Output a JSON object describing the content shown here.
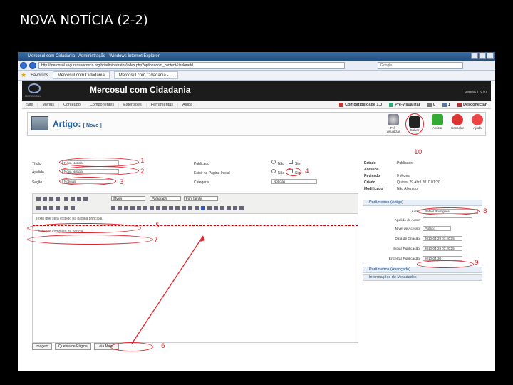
{
  "slide": {
    "title": "NOVA NOTÍCIA (2-2)"
  },
  "browser": {
    "window_title": "Mercosul com Cidadania - Administração - Windows Internet Explorer",
    "address": "http://mercosul.seguranseocosco.org.br/administrator/index.php?option=com_content&task=add",
    "search_placeholder": "Google",
    "favorites_label": "Favoritos",
    "tab_label": "Mercosul com Cidadania",
    "tab2_label": "Mercosul com Cidadania - ..."
  },
  "cms": {
    "site_name": "Mercosul com Cidadania",
    "logo_text": "MERCOSUL",
    "version": "Versão 1.5.10",
    "menu": [
      "Site",
      "Menus",
      "Conteúdo",
      "Componentes",
      "Extensões",
      "Ferramentas",
      "Ajuda"
    ],
    "menu_right": [
      "Compatibilidade 1.0",
      "Pré-visualizar",
      "0",
      "1",
      "Desconectar"
    ],
    "page_title": "Artigo:",
    "page_mode": "[ Novo ]",
    "toolbar": [
      "Pré-visualizar",
      "Salvar",
      "Aplicar",
      "Cancelar",
      "Ajuda"
    ]
  },
  "form": {
    "title_label": "Título",
    "title_value": "Nova Notícia",
    "alias_label": "Apelido",
    "alias_value": "Nova Notícia",
    "section_label": "Seção",
    "section_value": "Notícias",
    "published_label": "Publicado",
    "frontpage_label": "Exibir na Página Inicial",
    "category_label": "Categoria",
    "category_value": "Notícias",
    "no_label": "Não",
    "yes_label": "Sim"
  },
  "editor": {
    "styles_select": "Styles",
    "paragraph_select": "Paragraph",
    "font_select": "Font family",
    "intro_text": "Texto que será exibido na página principal.",
    "full_text": "Conteúdo completo da notícia.",
    "buttons": [
      "Imagem",
      "Quebra de Página",
      "Leia Mais..."
    ]
  },
  "info": {
    "rows": [
      {
        "label": "Estado",
        "value": "Publicado"
      },
      {
        "label": "Acessos",
        "value": ""
      },
      {
        "label": "Revisado",
        "value": "0 Vezes"
      },
      {
        "label": "Criado",
        "value": "Quinta, 29 Abril 2010 01:20"
      },
      {
        "label": "Modificado",
        "value": "Não Alterado"
      }
    ]
  },
  "params": {
    "header": "Parâmetros (Artigo)",
    "rows": [
      {
        "label": "Autor",
        "value": "Rafael Rodrigues"
      },
      {
        "label": "Apelido do Autor",
        "value": ""
      },
      {
        "label": "Nível de Acesso",
        "value": "Público"
      },
      {
        "label": "Data de Criação",
        "value": "2010-04-29 01:20:25"
      },
      {
        "label": "Iniciar Publicação",
        "value": "2010-04-29 01:20:25"
      },
      {
        "label": "Encerrar Publicação",
        "value": "2010-04-30"
      }
    ],
    "advanced_header": "Parâmetros (Avançado)",
    "meta_header": "Informações de Metadados"
  },
  "annotations": [
    "1",
    "2",
    "3",
    "4",
    "5",
    "6",
    "7",
    "8",
    "9",
    "10"
  ],
  "colors": {
    "annotation": "#e3232a",
    "link": "#1c62a8",
    "header_bg": "#1c1c1c"
  }
}
